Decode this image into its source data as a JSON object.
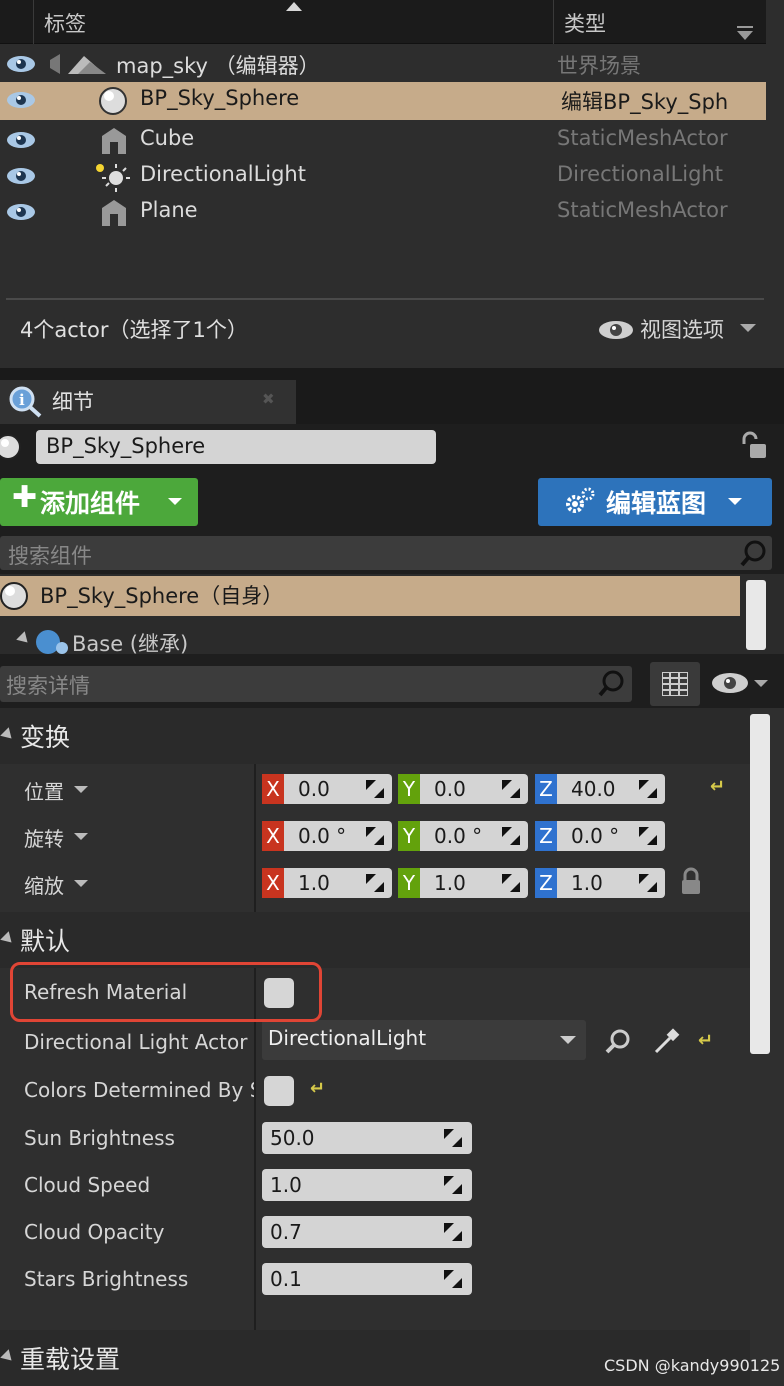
{
  "outliner": {
    "col_label": "标签",
    "col_type": "类型",
    "rows": [
      {
        "name": "map_sky （编辑器）",
        "type": "世界场景"
      },
      {
        "name": "BP_Sky_Sphere",
        "type": "编辑BP_Sky_Sph"
      },
      {
        "name": "Cube",
        "type": "StaticMeshActor"
      },
      {
        "name": "DirectionalLight",
        "type": "DirectionalLight"
      },
      {
        "name": "Plane",
        "type": "StaticMeshActor"
      }
    ],
    "count_text": "4个actor（选择了1个）",
    "view_options": "视图选项"
  },
  "details": {
    "tab_label": "细节",
    "actor_name": "BP_Sky_Sphere",
    "add_component": "添加组件",
    "edit_blueprint": "编辑蓝图",
    "search_components_placeholder": "搜索组件",
    "components": {
      "self": "BP_Sky_Sphere（自身）",
      "base": "Base (继承)"
    },
    "search_details_placeholder": "搜索详情",
    "transform": {
      "category": "变换",
      "location": {
        "label": "位置",
        "x": "0.0",
        "y": "0.0",
        "z": "40.0"
      },
      "rotation": {
        "label": "旋转",
        "x": "0.0 °",
        "y": "0.0 °",
        "z": "0.0 °"
      },
      "scale": {
        "label": "缩放",
        "x": "1.0",
        "y": "1.0",
        "z": "1.0"
      },
      "axis_x": "X",
      "axis_y": "Y",
      "axis_z": "Z"
    },
    "default": {
      "category": "默认",
      "refresh_material": "Refresh Material",
      "directional_light_actor": "Directional Light Actor",
      "directional_light_value": "DirectionalLight",
      "colors_determined": "Colors Determined By Su",
      "sun_brightness": {
        "label": "Sun Brightness",
        "value": "50.0"
      },
      "cloud_speed": {
        "label": "Cloud Speed",
        "value": "1.0"
      },
      "cloud_opacity": {
        "label": "Cloud Opacity",
        "value": "0.7"
      },
      "stars_brightness": {
        "label": "Stars Brightness",
        "value": "0.1"
      }
    },
    "overrides": {
      "category": "重载设置"
    }
  },
  "watermark": "CSDN @kandy990125",
  "colors": {
    "selection": "#c6ab8a",
    "add_button": "#4ca83b",
    "blueprint_button": "#2d73bb",
    "axis_x": "#c8341f",
    "axis_y": "#63a20c",
    "axis_z": "#2f72cf",
    "highlight": "#e04535"
  }
}
